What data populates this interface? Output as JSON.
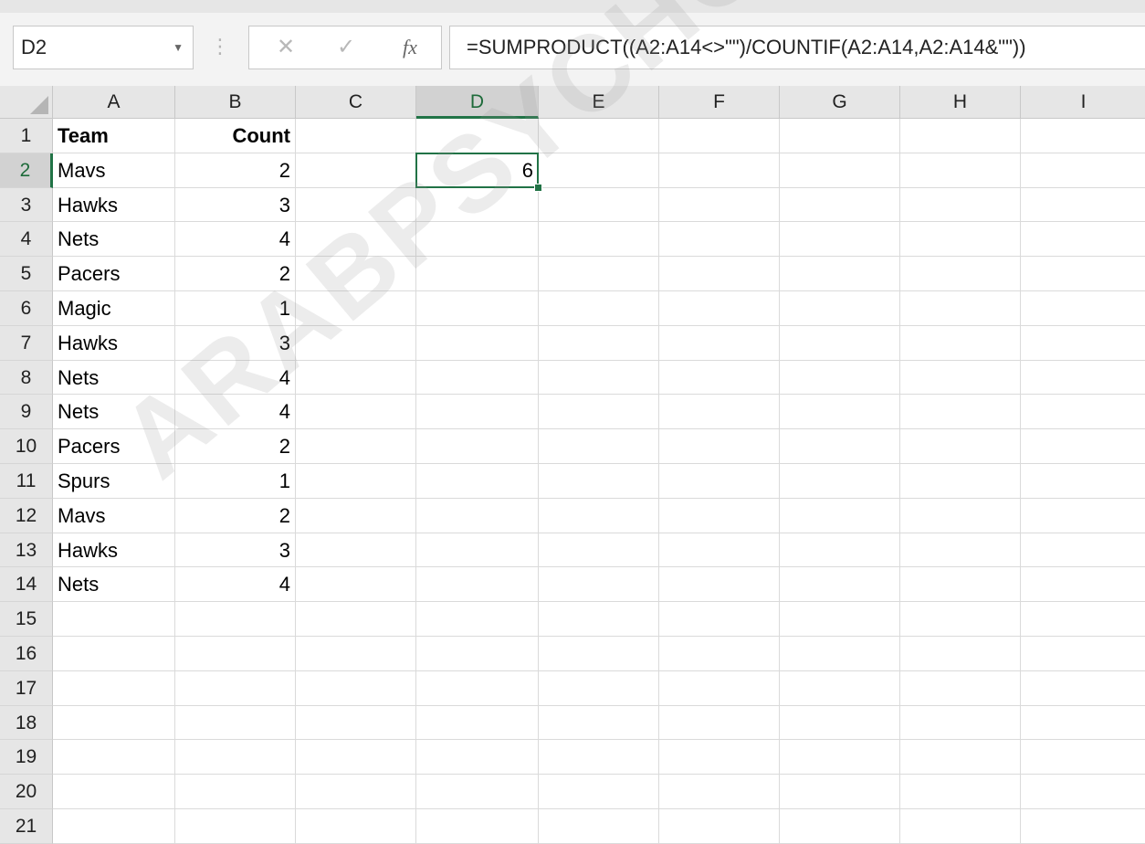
{
  "name_box": {
    "value": "D2"
  },
  "formula_bar": {
    "fx_symbol": "fx",
    "cancel_symbol": "✕",
    "enter_symbol": "✓",
    "dots": "⋮",
    "formula": "=SUMPRODUCT((A2:A14<>\"\")/COUNTIF(A2:A14,A2:A14&\"\"))"
  },
  "columns": [
    "A",
    "B",
    "C",
    "D",
    "E",
    "F",
    "G",
    "H",
    "I"
  ],
  "selected_column": "D",
  "selected_row": "2",
  "row_numbers": [
    "1",
    "2",
    "3",
    "4",
    "5",
    "6",
    "7",
    "8",
    "9",
    "10",
    "11",
    "12",
    "13",
    "14",
    "15",
    "16",
    "17",
    "18",
    "19",
    "20",
    "21"
  ],
  "cells": {
    "A1": "Team",
    "B1": "Count",
    "A2": "Mavs",
    "B2": "2",
    "D2": "6",
    "A3": "Hawks",
    "B3": "3",
    "A4": "Nets",
    "B4": "4",
    "A5": "Pacers",
    "B5": "2",
    "A6": "Magic",
    "B6": "1",
    "A7": "Hawks",
    "B7": "3",
    "A8": "Nets",
    "B8": "4",
    "A9": "Nets",
    "B9": "4",
    "A10": "Pacers",
    "B10": "2",
    "A11": "Spurs",
    "B11": "1",
    "A12": "Mavs",
    "B12": "2",
    "A13": "Hawks",
    "B13": "3",
    "A14": "Nets",
    "B14": "4"
  },
  "bold_cells": [
    "A1",
    "B1"
  ],
  "numeric_columns": [
    "B",
    "D"
  ],
  "active_cell": "D2",
  "watermark": "ARABPSYCHOLOGY",
  "colors": {
    "accent": "#217346",
    "header_bg": "#e6e6e6",
    "grid": "#dadada"
  }
}
